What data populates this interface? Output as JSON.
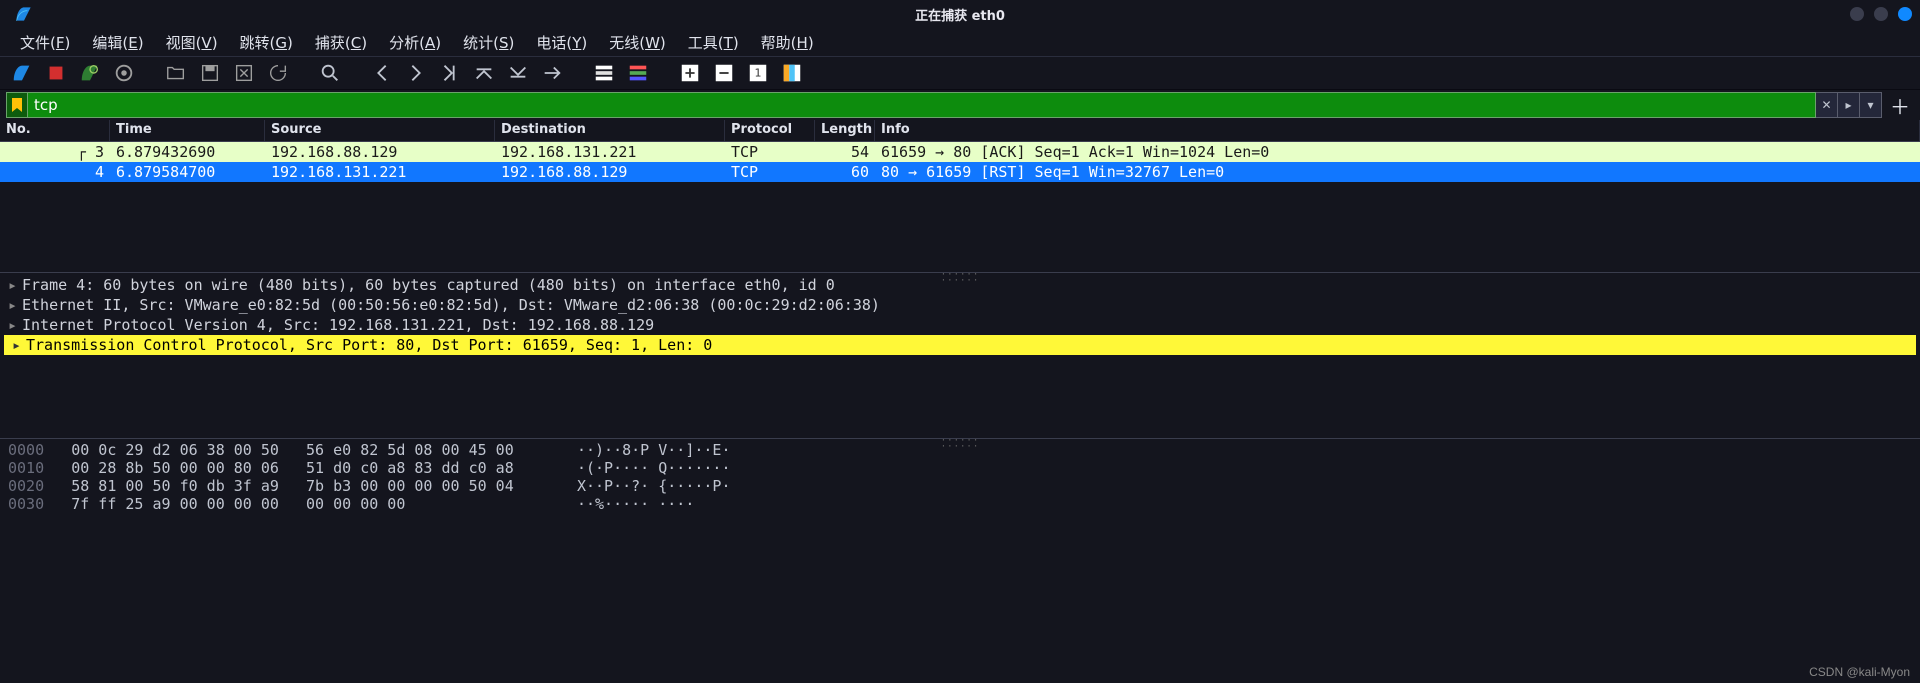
{
  "window": {
    "title": "正在捕获 eth0"
  },
  "menus": [
    {
      "label_pre": "文件(",
      "ul": "F",
      "label_post": ")"
    },
    {
      "label_pre": "编辑(",
      "ul": "E",
      "label_post": ")"
    },
    {
      "label_pre": "视图(",
      "ul": "V",
      "label_post": ")"
    },
    {
      "label_pre": "跳转(",
      "ul": "G",
      "label_post": ")"
    },
    {
      "label_pre": "捕获(",
      "ul": "C",
      "label_post": ")"
    },
    {
      "label_pre": "分析(",
      "ul": "A",
      "label_post": ")"
    },
    {
      "label_pre": "统计(",
      "ul": "S",
      "label_post": ")"
    },
    {
      "label_pre": "电话(",
      "ul": "Y",
      "label_post": ")"
    },
    {
      "label_pre": "无线(",
      "ul": "W",
      "label_post": ")"
    },
    {
      "label_pre": "工具(",
      "ul": "T",
      "label_post": ")"
    },
    {
      "label_pre": "帮助(",
      "ul": "H",
      "label_post": ")"
    }
  ],
  "filter": {
    "value": "tcp"
  },
  "columns": {
    "no": "No.",
    "time": "Time",
    "src": "Source",
    "dst": "Destination",
    "proto": "Protocol",
    "len": "Length",
    "info": "Info"
  },
  "packets": [
    {
      "no": "3",
      "time": "6.879432690",
      "src": "192.168.88.129",
      "dst": "192.168.131.221",
      "proto": "TCP",
      "len": "54",
      "info": "61659 → 80 [ACK]  Seq=1 Ack=1 Win=1024 Len=0"
    },
    {
      "no": "4",
      "time": "6.879584700",
      "src": "192.168.131.221",
      "dst": "192.168.88.129",
      "proto": "TCP",
      "len": "60",
      "info": "80 → 61659 [RST]  Seq=1 Win=32767 Len=0"
    }
  ],
  "details": [
    "Frame 4: 60 bytes on wire (480 bits), 60 bytes captured (480 bits) on interface eth0, id 0",
    "Ethernet II, Src: VMware_e0:82:5d (00:50:56:e0:82:5d), Dst: VMware_d2:06:38 (00:0c:29:d2:06:38)",
    "Internet Protocol Version 4, Src: 192.168.131.221, Dst: 192.168.88.129",
    "Transmission Control Protocol, Src Port: 80, Dst Port: 61659, Seq: 1, Len: 0"
  ],
  "hex": [
    {
      "offset": "0000",
      "bytes": "00 0c 29 d2 06 38 00 50   56 e0 82 5d 08 00 45 00",
      "ascii": "··)··8·P V··]··E·"
    },
    {
      "offset": "0010",
      "bytes": "00 28 8b 50 00 00 80 06   51 d0 c0 a8 83 dd c0 a8",
      "ascii": "·(·P···· Q·······"
    },
    {
      "offset": "0020",
      "bytes": "58 81 00 50 f0 db 3f a9   7b b3 00 00 00 00 50 04",
      "ascii": "X··P··?· {·····P·"
    },
    {
      "offset": "0030",
      "bytes": "7f ff 25 a9 00 00 00 00   00 00 00 00",
      "ascii": "··%····· ····"
    }
  ],
  "watermark": "CSDN @kali-Myon"
}
